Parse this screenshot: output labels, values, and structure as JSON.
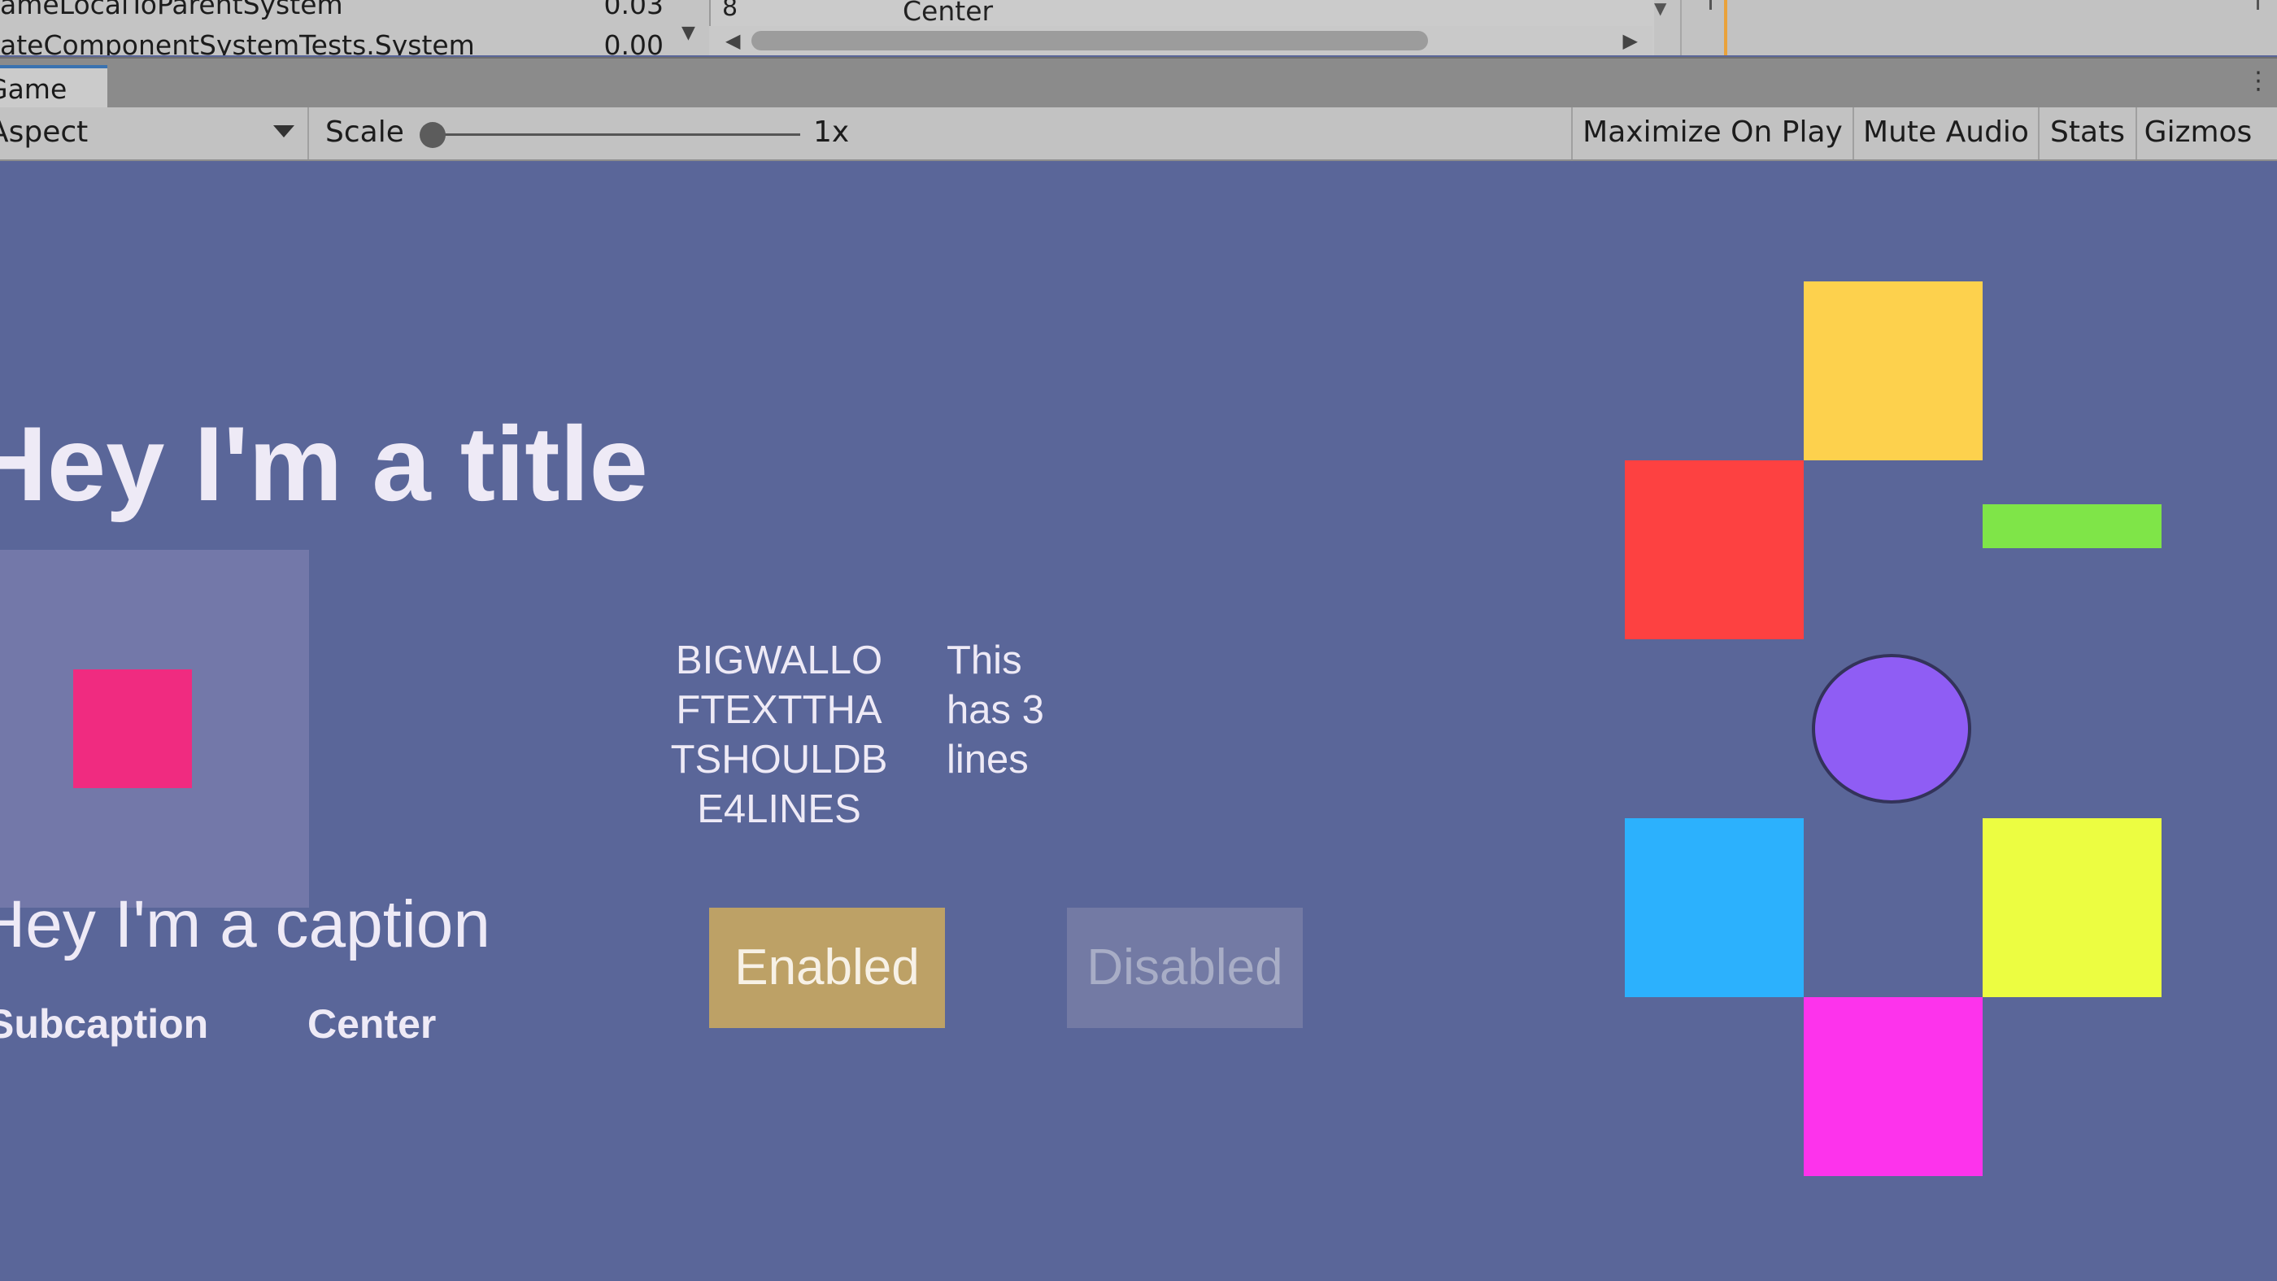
{
  "profiler": {
    "rows": [
      {
        "name": "ameLocalToParentSystem",
        "value": "0.03"
      },
      {
        "name": "ateComponentSystemTests.System",
        "value": "0.00"
      }
    ],
    "detail": {
      "number": "8",
      "label": "Center"
    }
  },
  "tabs": {
    "game": "Game"
  },
  "toolbar": {
    "aspect": "Aspect",
    "scale_label": "Scale",
    "scale_value": "1x",
    "maximize": "Maximize On Play",
    "mute": "Mute Audio",
    "stats": "Stats",
    "gizmos": "Gizmos"
  },
  "game": {
    "title": "Hey I'm a title",
    "caption": "Hey I'm a caption",
    "subcaption": "Subcaption",
    "center": "Center",
    "bigwall": "BIGWALLO\nFTEXTTHA\nTSHOULDB\nE4LINES",
    "three_lines": "This\nhas 3\nlines",
    "enabled": "Enabled",
    "disabled": "Disabled"
  },
  "colors": {
    "background": "#5a6699",
    "yellow": "#fdd14d",
    "red": "#fd4141",
    "green": "#7fe548",
    "purple": "#8f5df4",
    "blue": "#2cb1fd",
    "lime": "#ecfd41",
    "magenta": "#fd33ec",
    "pink": "#f02b80",
    "enabled": "#bda166"
  }
}
